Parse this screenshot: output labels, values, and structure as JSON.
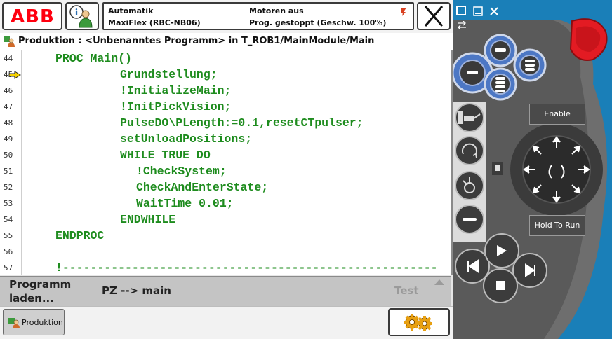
{
  "header": {
    "logo_text": "ABB",
    "mode": "Automatik",
    "controller": "MaxiFlex (RBC-NB06)",
    "motors": "Motoren aus",
    "program_state": "Prog. gestoppt (Geschw. 100%)"
  },
  "titlebar": {
    "text": "Produktion : <Unbenanntes Programm> in T_ROB1/MainModule/Main"
  },
  "code": {
    "lines": [
      {
        "num": "44",
        "text": "PROC Main()"
      },
      {
        "num": "45",
        "text": "Grundstellung;"
      },
      {
        "num": "46",
        "text": "!InitializeMain;"
      },
      {
        "num": "47",
        "text": "!InitPickVision;"
      },
      {
        "num": "48",
        "text": "PulseDO\\PLength:=0.1,resetCTpulser;"
      },
      {
        "num": "49",
        "text": "setUnloadPositions;"
      },
      {
        "num": "50",
        "text": "WHILE TRUE DO"
      },
      {
        "num": "51",
        "text": "!CheckSystem;"
      },
      {
        "num": "52",
        "text": "CheckAndEnterState;"
      },
      {
        "num": "53",
        "text": "WaitTime 0.01;"
      },
      {
        "num": "54",
        "text": "ENDWHILE"
      },
      {
        "num": "55",
        "text": "ENDPROC"
      },
      {
        "num": "56",
        "text": ""
      },
      {
        "num": "57",
        "text": "!------------------------------------------------------"
      }
    ]
  },
  "bottom": {
    "load_program": "Programm laden...",
    "pp_to_main": "PZ --> main",
    "test": "Test"
  },
  "taskbar": {
    "production": "Produktion"
  },
  "pendant": {
    "enable": "Enable",
    "hold_to_run": "Hold To Run"
  },
  "colors": {
    "code_text": "#1e8c1e",
    "abb_red": "#ff000f",
    "pendant_blue": "#1a7fb8",
    "stop_red": "#e31b23"
  }
}
